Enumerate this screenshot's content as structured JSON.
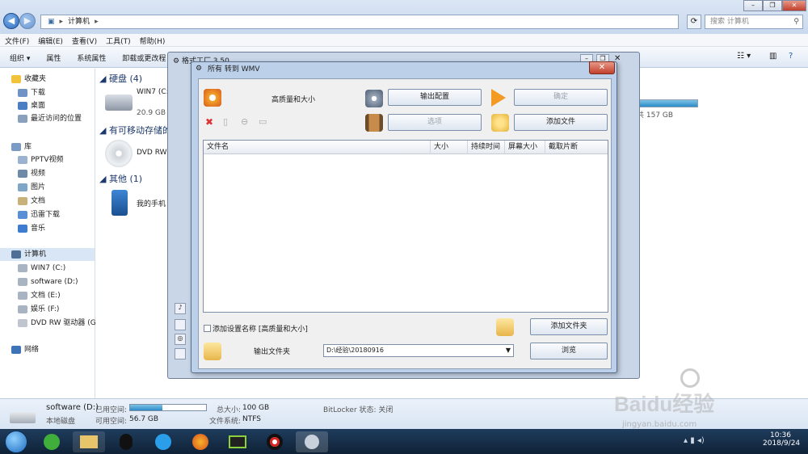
{
  "explorer": {
    "address": [
      "计算机"
    ],
    "search_placeholder": "搜索 计算机",
    "menu": [
      "文件(F)",
      "编辑(E)",
      "查看(V)",
      "工具(T)",
      "帮助(H)"
    ],
    "toolbar": [
      "组织 ▾",
      "属性",
      "系统属性",
      "卸载或更改程"
    ],
    "sidebar": {
      "favorites": "收藏夹",
      "fav_items": [
        "下载",
        "桌面",
        "最近访问的位置"
      ],
      "library": "库",
      "lib_items": [
        "PPTV视频",
        "视频",
        "图片",
        "文档",
        "迅雷下载",
        "音乐"
      ],
      "computer": "计算机",
      "drives": [
        "WIN7 (C:)",
        "software (D:)",
        "文档 (E:)",
        "娱乐 (F:)",
        "DVD RW 驱动器 (G"
      ],
      "network": "网络"
    },
    "content": {
      "hdd_group": "硬盘 (4)",
      "drive_name": "WIN7 (C:",
      "drive_space": "20.9 GB",
      "drive_right_space": "共 157 GB",
      "removable_group": "有可移动存储的",
      "dvd": "DVD RW",
      "other_group": "其他 (1)",
      "phone": "我的手机"
    },
    "details": {
      "name": "software (D:)",
      "type": "本地磁盘",
      "used_label": "已用空间:",
      "free_label": "可用空间:",
      "free_value": "56.7 GB",
      "total_label": "总大小:",
      "total_value": "100 GB",
      "fs_label": "文件系统:",
      "fs_value": "NTFS",
      "bitlocker": "BitLocker 状态: 关闭",
      "used_fraction": 0.43
    }
  },
  "converter": {
    "outer_title": "格式工厂 3.50",
    "title": "所有 转到 WMV",
    "quality": "高质量和大小",
    "output_config": "输出配置",
    "ok": "确定",
    "options": "选项",
    "add_file": "添加文件",
    "columns": [
      "文件名",
      "大小",
      "持续时间",
      "屏幕大小",
      "截取片断"
    ],
    "add_setting_name": "添加设置名称 [高质量和大小]",
    "add_folder": "添加文件夹",
    "output_folder_label": "输出文件夹",
    "output_folder_value": "D:\\经验\\20180916",
    "browse": "浏览"
  },
  "clock": {
    "time": "10:36",
    "date": "2018/9/24"
  },
  "watermark": {
    "brand": "Baidu经验",
    "url": "jingyan.baidu.com"
  }
}
